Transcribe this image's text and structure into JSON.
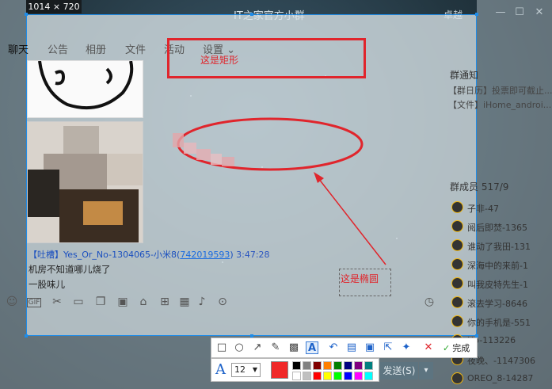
{
  "capture": {
    "size_label": "1014 × 720"
  },
  "window": {
    "title": "IT之家官方小群",
    "minimize": "—",
    "maximize": "☐",
    "close": "✕",
    "extra": "卓越"
  },
  "tabs": [
    "聊天",
    "公告",
    "相册",
    "文件",
    "活动",
    "设置 ⌄"
  ],
  "chat": {
    "sender": "【吐槽】Yes_Or_No-1304065-小米8(",
    "sender_qq": "742019593",
    "sender_close": ")",
    "time": "3:47:28",
    "line1": "机房不知道哪儿烧了",
    "line2": "一股味儿"
  },
  "input_icons": [
    "smile-icon",
    "gif-icon",
    "scissors-icon",
    "folder-icon",
    "doc-icon",
    "image-icon",
    "gift-icon",
    "gift2-icon",
    "calendar-icon",
    "bell-icon",
    "more-icon",
    "clock-icon"
  ],
  "right_panel": {
    "notice_title": "群通知",
    "notice_lines": [
      "【群日历】投票即可截止...",
      "【文件】iHome_androi..."
    ],
    "members_title": "群成员 517/9",
    "members": [
      "子非-47",
      "阅后即焚-1365",
      "谁动了我田-131",
      "深海中的来前-1",
      "叫我皮特先生-1",
      "滚去学习-8646",
      "你的手机是-551",
      "Ho-113226",
      "夜晚、-1147306",
      "OREO_8-14287"
    ]
  },
  "annotations": {
    "rect_label": "这是矩形",
    "ellipse_label": "这是椭圆"
  },
  "toolbar": {
    "tools": [
      "rect-tool",
      "ellipse-tool",
      "arrow-tool",
      "brush-tool",
      "mosaic-tool",
      "text-tool",
      "undo-tool",
      "save-tool",
      "pin-tool",
      "share-tool",
      "bookmark-tool",
      "cancel-tool"
    ],
    "done_label": "完成",
    "font_size": "12",
    "current_color": "#f02828",
    "palette": [
      "#000000",
      "#808080",
      "#800000",
      "#ff8000",
      "#008000",
      "#000080",
      "#800080",
      "#008080",
      "#ffffff",
      "#c0c0c0",
      "#ff0000",
      "#ffff00",
      "#00ff00",
      "#0000ff",
      "#ff00ff",
      "#00ffff"
    ]
  },
  "send": {
    "label": "发送(S)",
    "arrow": "▾"
  }
}
